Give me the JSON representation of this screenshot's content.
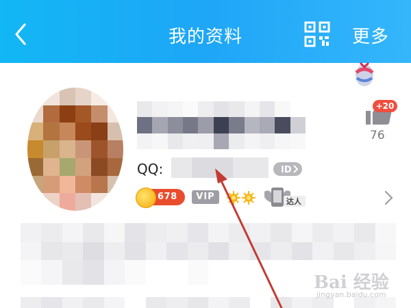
{
  "header": {
    "title": "我的资料",
    "more_label": "更多",
    "back_icon": "chevron-left-icon",
    "qr_icon": "qr-code-icon",
    "background_color": "#1ea6f7"
  },
  "profile": {
    "qq_label": "QQ:",
    "id_icon_label": "ID",
    "likes": {
      "badge": "+20",
      "count": "76"
    },
    "badges": {
      "coins": "678",
      "vip": "VIP",
      "master": "达人"
    }
  },
  "watermark": {
    "text": "Bai 经验",
    "url": "jingyan.baidu.com"
  },
  "colors": {
    "accent": "#1ea6f7",
    "arrow": "#c33b33",
    "badge_red": "#f04e3e"
  }
}
